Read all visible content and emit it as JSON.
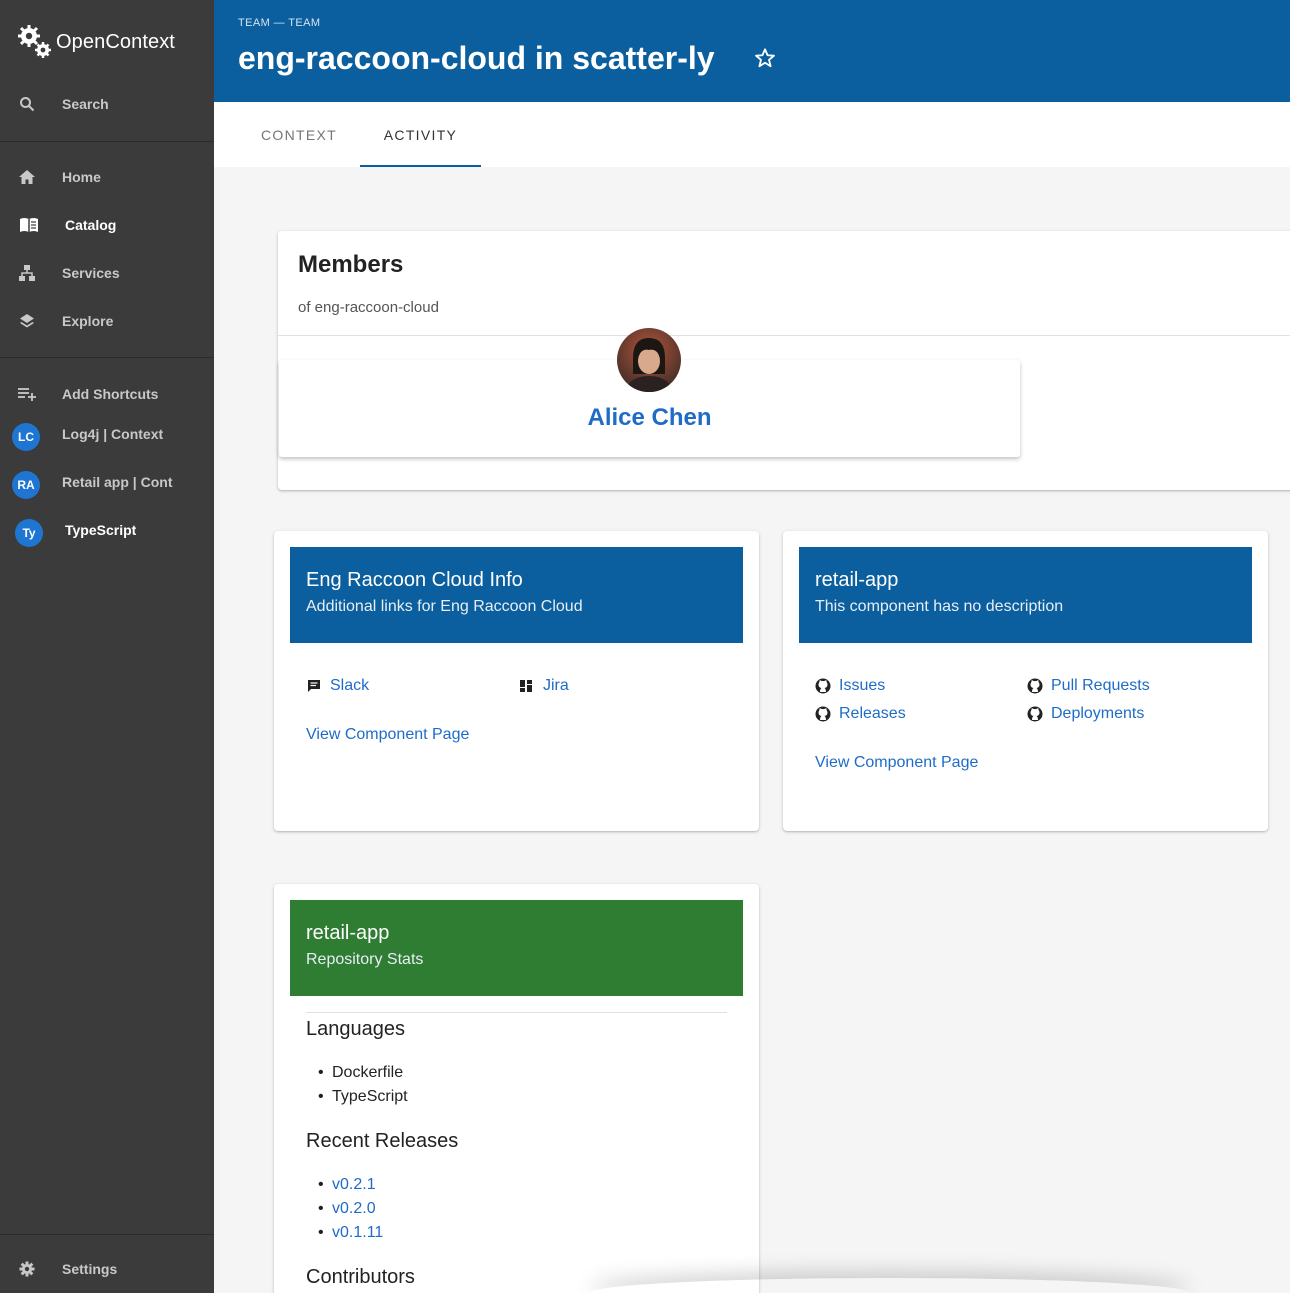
{
  "sidebar": {
    "logo_text": "OpenContext",
    "search_label": "Search",
    "nav": [
      {
        "label": "Home",
        "icon": "home-icon"
      },
      {
        "label": "Catalog",
        "icon": "book-icon"
      },
      {
        "label": "Services",
        "icon": "sitemap-icon"
      },
      {
        "label": "Explore",
        "icon": "layers-icon"
      }
    ],
    "add_shortcuts_label": "Add Shortcuts",
    "shortcuts": [
      {
        "initials": "LC",
        "label": "Log4j | Context"
      },
      {
        "initials": "RA",
        "label": "Retail app | Context"
      },
      {
        "initials": "Ty",
        "label": "TypeScript"
      }
    ],
    "settings_label": "Settings"
  },
  "header": {
    "crumb": "TEAM — TEAM",
    "title": "eng-raccoon-cloud in scatter-ly"
  },
  "tabs": [
    {
      "label": "CONTEXT",
      "active": false
    },
    {
      "label": "ACTIVITY",
      "active": true
    }
  ],
  "members": {
    "title": "Members",
    "subtitle": "of eng-raccoon-cloud",
    "people": [
      {
        "name": "Alice Chen"
      }
    ]
  },
  "info_card": {
    "title": "Eng Raccoon Cloud Info",
    "subtitle": "Additional links for Eng Raccoon Cloud",
    "links": [
      {
        "label": "Slack",
        "icon": "chat-icon"
      },
      {
        "label": "Jira",
        "icon": "dashboard-icon"
      }
    ],
    "view_label": "View Component Page"
  },
  "retail_card": {
    "title": "retail-app",
    "subtitle": "This component has no description",
    "links": [
      {
        "label": "Issues",
        "icon": "github-icon"
      },
      {
        "label": "Pull Requests",
        "icon": "github-icon"
      },
      {
        "label": "Releases",
        "icon": "github-icon"
      },
      {
        "label": "Deployments",
        "icon": "github-icon"
      }
    ],
    "view_label": "View Component Page"
  },
  "stats_card": {
    "title": "retail-app",
    "subtitle": "Repository Stats",
    "languages_title": "Languages",
    "languages": [
      "Dockerfile",
      "TypeScript"
    ],
    "releases_title": "Recent Releases",
    "releases": [
      "v0.2.1",
      "v0.2.0",
      "v0.1.11"
    ],
    "contributors_title": "Contributors"
  },
  "colors": {
    "sidebar_bg": "#3b3b3b",
    "header_bg": "#0b5f9e",
    "link": "#1f6cc8",
    "stats_header": "#2e7d32",
    "avatar_bg": "#1f76d2"
  }
}
